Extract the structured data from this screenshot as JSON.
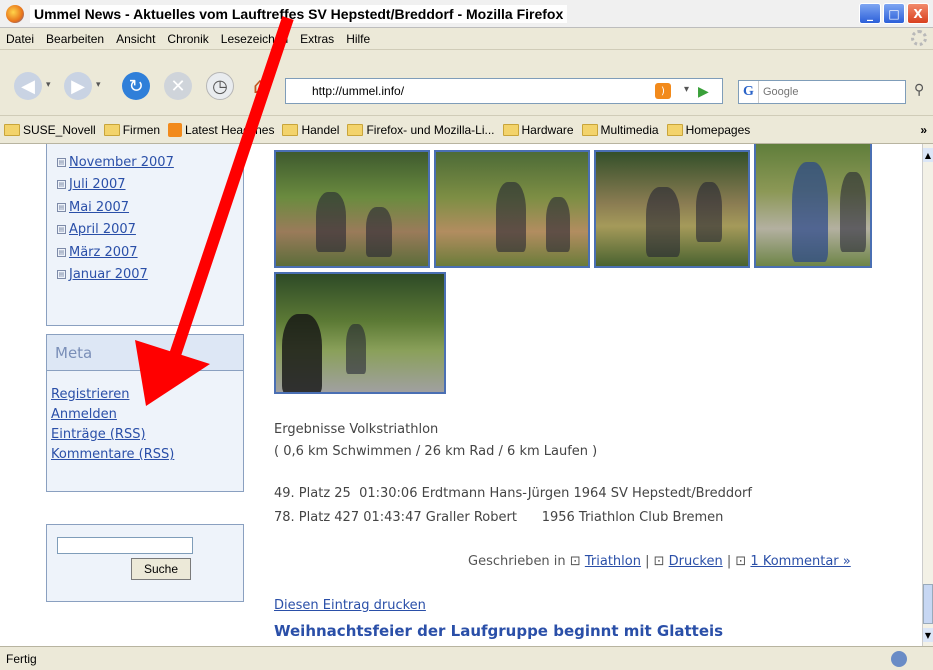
{
  "window": {
    "title": "Ummel News - Aktuelles vom Lauftreffes SV Hepstedt/Breddorf - Mozilla Firefox",
    "minimize": "_",
    "maximize": "□",
    "close": "X"
  },
  "menu": [
    "Datei",
    "Bearbeiten",
    "Ansicht",
    "Chronik",
    "Lesezeichen",
    "Extras",
    "Hilfe"
  ],
  "toolbar": {
    "url": "http://ummel.info/",
    "search_engine": "G",
    "search_placeholder": "Google"
  },
  "bookmarks": [
    {
      "label": "SUSE_Novell",
      "icon": "folder-icon"
    },
    {
      "label": "Firmen",
      "icon": "folder-icon"
    },
    {
      "label": "Latest Headlines",
      "icon": "rss-icon"
    },
    {
      "label": "Handel",
      "icon": "folder-icon"
    },
    {
      "label": "Firefox- und Mozilla-Li...",
      "icon": "folder-icon"
    },
    {
      "label": "Hardware",
      "icon": "folder-icon"
    },
    {
      "label": "Multimedia",
      "icon": "folder-icon"
    },
    {
      "label": "Homepages",
      "icon": "folder-icon"
    }
  ],
  "bookmarks_more": "»",
  "sidebar": {
    "archive": [
      "November 2007",
      "Juli 2007",
      "Mai 2007",
      "April 2007",
      "März 2007",
      "Januar 2007"
    ],
    "meta_title": "Meta",
    "meta_links": [
      "Registrieren",
      "Anmelden",
      "Einträge (RSS)",
      "Kommentare (RSS)"
    ],
    "search_button": "Suche"
  },
  "post": {
    "results_title": "Ergebnisse Volkstriathlon",
    "results_sub": "( 0,6 km Schwimmen / 26 km Rad / 6 km Laufen )",
    "result1": "49. Platz 25  01:30:06 Erdtmann Hans-Jürgen 1964 SV Hepstedt/Breddorf",
    "result2": "78. Platz 427 01:43:47 Graller Robert      1956 Triathlon Club Bremen",
    "posted_prefix": "Geschrieben in",
    "category": "Triathlon",
    "print": "Drucken",
    "comments": "1 Kommentar »",
    "print_entry": "Diesen Eintrag drucken",
    "next_title": "Weihnachtsfeier der Laufgruppe beginnt mit Glatteis"
  },
  "status": "Fertig",
  "colors": {
    "link": "#2a4fa8",
    "annotation_arrow": "#ff0000"
  }
}
